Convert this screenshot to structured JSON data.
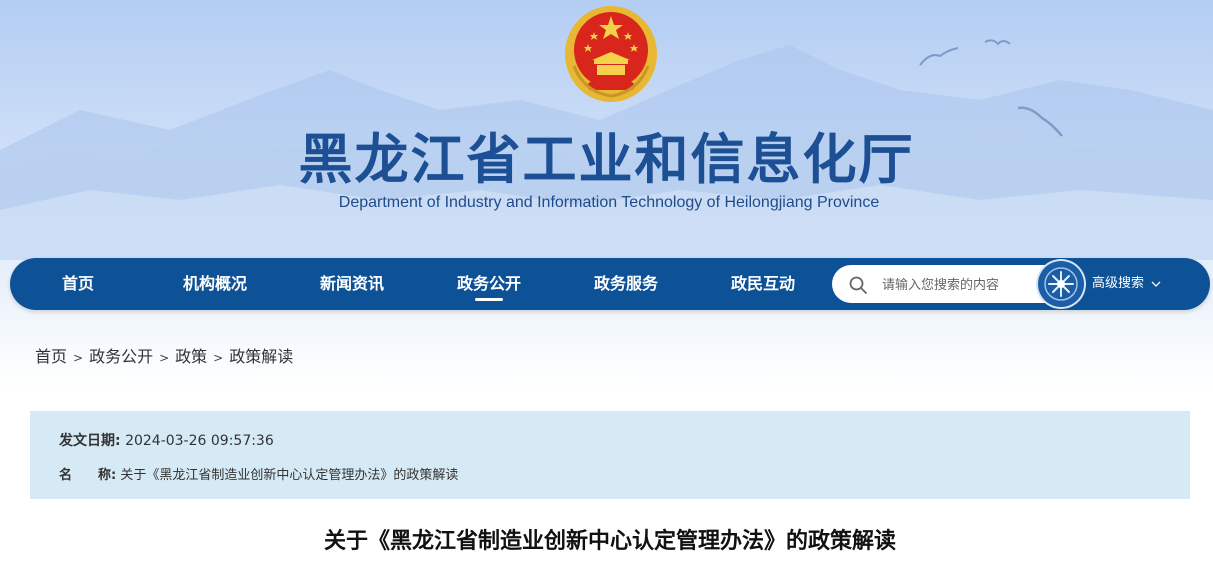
{
  "header": {
    "title": "黑龙江省工业和信息化厅",
    "subtitle": "Department of Industry and Information Technology of Heilongjiang Province",
    "emblem_icon": "national-emblem-icon"
  },
  "nav": {
    "items": [
      {
        "label": "首页"
      },
      {
        "label": "机构概况"
      },
      {
        "label": "新闻资讯"
      },
      {
        "label": "政务公开"
      },
      {
        "label": "政务服务"
      },
      {
        "label": "政民互动"
      }
    ],
    "active_item": "政务公开",
    "search_placeholder": "请输入您搜索的内容",
    "advanced_search_label": "高级搜索",
    "colors": {
      "nav_bg": "#0d5196",
      "title": "#1d4f95"
    }
  },
  "breadcrumb": {
    "items": [
      "首页",
      "政务公开",
      "政策",
      "政策解读"
    ],
    "separator": ">"
  },
  "info": {
    "date_label": "发文日期:",
    "date_value": "2024-03-26 09:57:36",
    "name_label": "名　　称:",
    "name_value": "关于《黑龙江省制造业创新中心认定管理办法》的政策解读",
    "colors": {
      "box_bg": "#d6eaf5"
    }
  },
  "article": {
    "title": "关于《黑龙江省制造业创新中心认定管理办法》的政策解读"
  }
}
